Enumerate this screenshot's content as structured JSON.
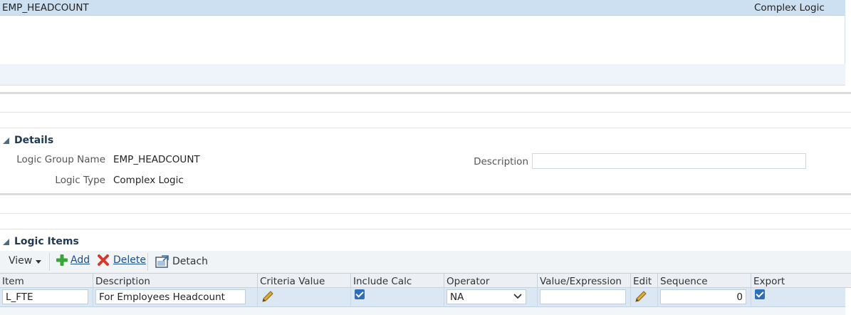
{
  "top_list": {
    "selected_row": {
      "name": "EMP_HEADCOUNT",
      "type": "Complex Logic"
    }
  },
  "details": {
    "section_title": "Details",
    "logic_group_name_label": "Logic Group Name",
    "logic_group_name_value": "EMP_HEADCOUNT",
    "logic_type_label": "Logic Type",
    "logic_type_value": "Complex Logic",
    "description_label": "Description",
    "description_value": ""
  },
  "logic_items": {
    "section_title": "Logic Items",
    "toolbar": {
      "view_label": "View",
      "add_label": "Add",
      "delete_label": "Delete",
      "detach_label": "Detach"
    },
    "columns": [
      "Item",
      "Description",
      "Criteria Value",
      "Include Calc",
      "Operator",
      "Value/Expression",
      "Edit",
      "Sequence",
      "Export"
    ],
    "rows": [
      {
        "item": "L_FTE",
        "description": "For Employees Headcount",
        "include_calc": true,
        "operator": "NA",
        "value_expression": "",
        "sequence": "0",
        "export": true
      }
    ]
  },
  "colors": {
    "selected_row": "#cde0f2",
    "accent": "#1f3a56",
    "add_green": "#3aa33a",
    "delete_red": "#d23a2a"
  },
  "icons": [
    "collapse-triangle-icon",
    "add-icon",
    "delete-icon",
    "detach-icon",
    "pencil-icon",
    "chevron-down-icon",
    "checkbox-icon"
  ]
}
